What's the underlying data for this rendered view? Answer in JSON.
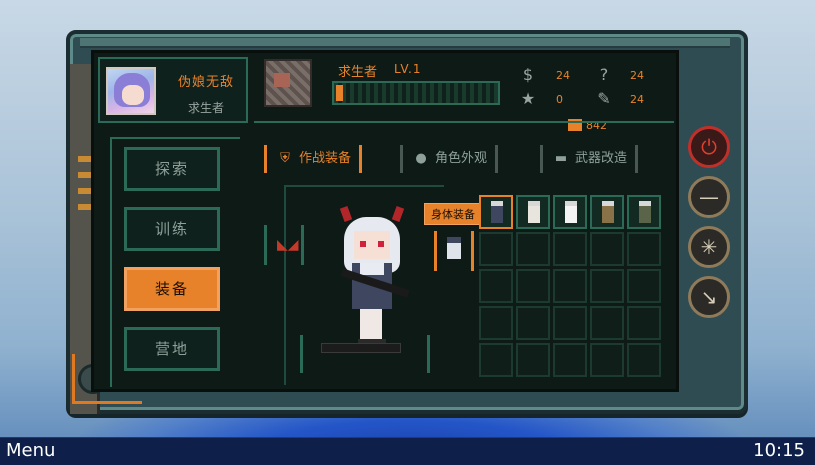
{
  "player": {
    "name": "伪娘无敌",
    "title": "求生者"
  },
  "rank": {
    "title": "求生者",
    "level": "LV.1",
    "xp_progress": 0.02
  },
  "stats": {
    "coins": "24",
    "stars": "0",
    "quests": "24",
    "tools": "24",
    "currency": "842"
  },
  "nav": {
    "items": [
      {
        "label": "探索",
        "active": false
      },
      {
        "label": "训练",
        "active": false
      },
      {
        "label": "装备",
        "active": true
      },
      {
        "label": "营地",
        "active": false
      }
    ]
  },
  "tabs": [
    {
      "label": "作战装备",
      "icon": "armor-icon",
      "active": true
    },
    {
      "label": "角色外观",
      "icon": "person-icon",
      "active": false
    },
    {
      "label": "武器改造",
      "icon": "rifle-icon",
      "active": false
    }
  ],
  "equipment": {
    "body_slot_label": "身体装备"
  },
  "inventory": {
    "outfits": [
      {
        "name": "school-uniform-outfit",
        "color": "#3e4660"
      },
      {
        "name": "white-dress-outfit",
        "color": "#e8e4de"
      },
      {
        "name": "wedding-dress-outfit",
        "color": "#f4f4f4"
      },
      {
        "name": "desert-camo-outfit",
        "color": "#8a7248"
      },
      {
        "name": "forest-camo-outfit",
        "color": "#5a6448"
      }
    ]
  },
  "side_buttons": [
    {
      "name": "power-icon",
      "glyph": "⏻"
    },
    {
      "name": "minus-icon",
      "glyph": "—"
    },
    {
      "name": "settings-icon",
      "glyph": "✳"
    },
    {
      "name": "arrow-down-right-icon",
      "glyph": "↘"
    }
  ],
  "taskbar": {
    "menu_label": "Menu",
    "clock": "10:15"
  },
  "colors": {
    "accent": "#e8822a",
    "panel_border": "#2a6a56",
    "screen_bg": "#0d1a16",
    "power_red": "#c0302a"
  }
}
